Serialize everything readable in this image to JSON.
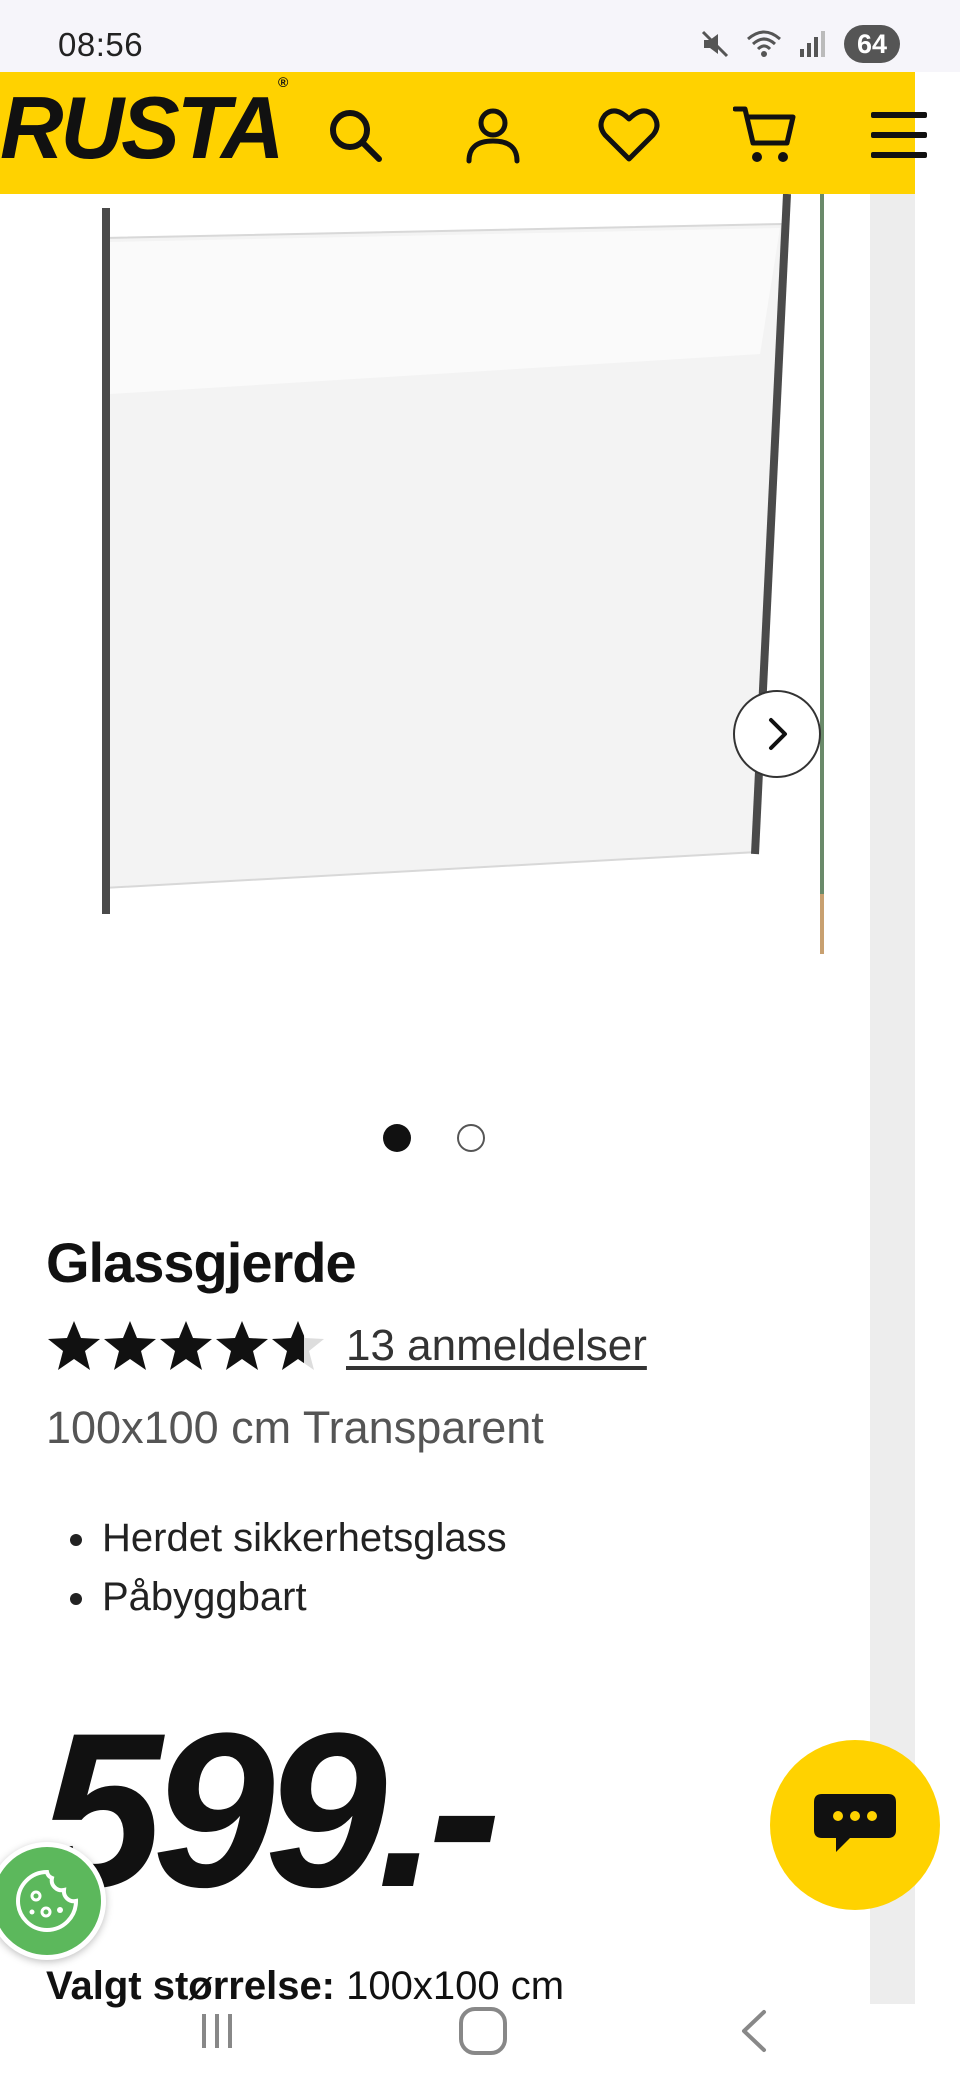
{
  "status_bar": {
    "time": "08:56",
    "battery": "64",
    "icons": [
      "mute-icon",
      "wifi-icon",
      "signal-icon"
    ]
  },
  "header": {
    "logo_text": "RUSTA",
    "logo_mark": "®",
    "icons": [
      "search-icon",
      "account-icon",
      "heart-icon",
      "cart-icon",
      "menu-icon"
    ],
    "brand_color": "#ffd200"
  },
  "gallery": {
    "image_count": 2,
    "active_index": 0
  },
  "product": {
    "title": "Glassgjerde",
    "rating": 4.6,
    "rating_max": 5,
    "review_link": "13 anmeldelser",
    "variant": "100x100 cm Transparent",
    "features": [
      "Herdet sikkerhetsglass",
      "Påbyggbart"
    ],
    "price": "599.-",
    "size_label": "Valgt størrelse:",
    "size_value": "100x100 cm"
  },
  "floating": {
    "chat_icon": "chat-bubble-icon",
    "cookie_icon": "cookie-icon"
  }
}
